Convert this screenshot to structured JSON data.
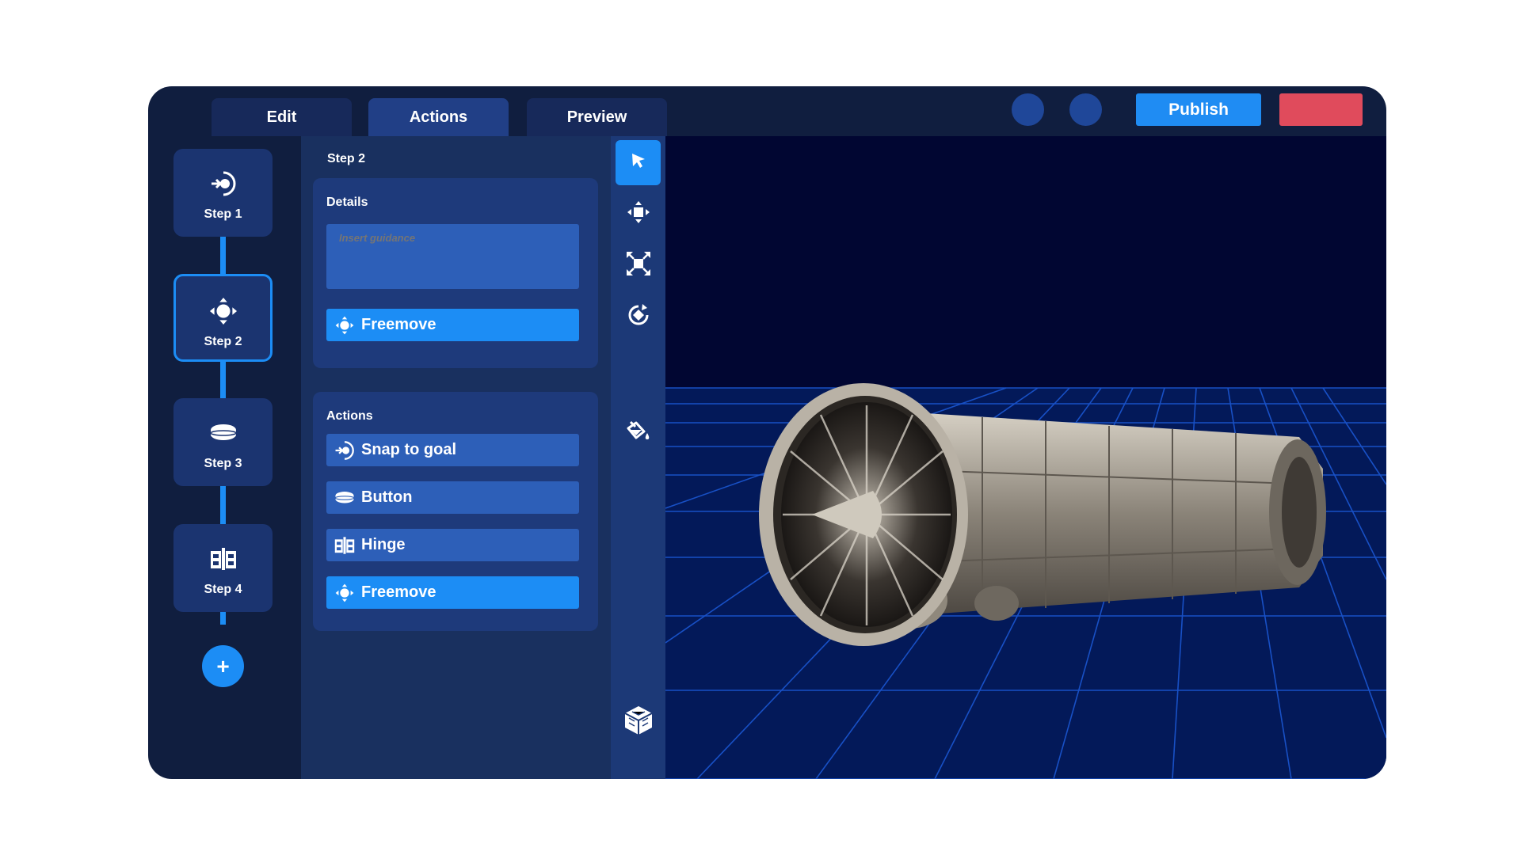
{
  "tabs": [
    {
      "label": "Edit",
      "active": false
    },
    {
      "label": "Actions",
      "active": true
    },
    {
      "label": "Preview",
      "active": false
    }
  ],
  "toolbar": {
    "publish_label": "Publish"
  },
  "steps": [
    {
      "label": "Step 1",
      "icon": "snap-icon",
      "selected": false
    },
    {
      "label": "Step 2",
      "icon": "freemove-icon",
      "selected": true
    },
    {
      "label": "Step 3",
      "icon": "button-icon",
      "selected": false
    },
    {
      "label": "Step 4",
      "icon": "hinge-icon",
      "selected": false
    }
  ],
  "add_step_label": "+",
  "panel": {
    "title": "Step 2",
    "details": {
      "title": "Details",
      "guidance_placeholder": "Insert guidance",
      "freemove_label": "Freemove"
    },
    "actions": {
      "title": "Actions",
      "items": [
        {
          "label": "Snap to goal",
          "icon": "snap-icon"
        },
        {
          "label": "Button",
          "icon": "button-icon"
        },
        {
          "label": "Hinge",
          "icon": "hinge-icon"
        },
        {
          "label": "Freemove",
          "icon": "freemove-icon",
          "highlighted": true
        }
      ]
    }
  },
  "tools": [
    "cursor-icon",
    "move-icon",
    "scale-icon",
    "rotate-icon",
    "paint-icon",
    "cube-icon"
  ],
  "colors": {
    "accent": "#1c8df5",
    "background": "#101e3f",
    "viewport": "#010632",
    "grid": "#1c5ad8",
    "danger": "#e04b5c"
  }
}
